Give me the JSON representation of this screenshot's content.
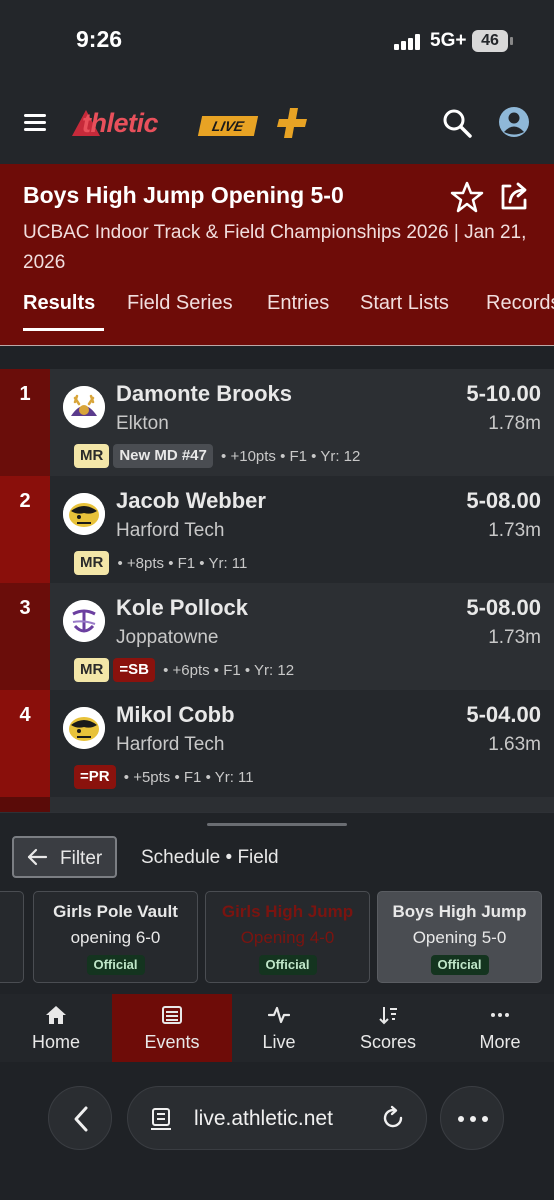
{
  "status_bar": {
    "time": "9:26",
    "network": "5G+",
    "battery": "46"
  },
  "header": {
    "logo_text": "thletic",
    "logo_badge": "LIVE"
  },
  "event": {
    "title": "Boys High Jump Opening 5-0",
    "subtitle": "UCBAC Indoor Track & Field Championships 2026 | Jan 21, 2026",
    "tabs": [
      "Results",
      "Field Series",
      "Entries",
      "Start Lists",
      "Records"
    ]
  },
  "results": [
    {
      "place": "1",
      "name": "Damonte Brooks",
      "school": "Elkton",
      "mark": "5-10.00",
      "metric": "1.78m",
      "badges": [
        "MR",
        "New MD #47"
      ],
      "meta": "• +10pts • F1 • Yr: 12"
    },
    {
      "place": "2",
      "name": "Jacob Webber",
      "school": "Harford Tech",
      "mark": "5-08.00",
      "metric": "1.73m",
      "badges": [
        "MR"
      ],
      "meta": "• +8pts • F1 • Yr: 11"
    },
    {
      "place": "3",
      "name": "Kole Pollock",
      "school": "Joppatowne",
      "mark": "5-08.00",
      "metric": "1.73m",
      "badges": [
        "MR",
        "=SB"
      ],
      "meta": "• +6pts • F1 • Yr: 12"
    },
    {
      "place": "4",
      "name": "Mikol Cobb",
      "school": "Harford Tech",
      "mark": "5-04.00",
      "metric": "1.63m",
      "badges": [
        "=PR"
      ],
      "meta": "• +5pts • F1 • Yr: 11"
    }
  ],
  "filter_sheet": {
    "filter_label": "Filter",
    "schedule_label": "Schedule • Field",
    "cards": [
      {
        "title": "Girls Pole Vault",
        "subtitle": "opening 6-0",
        "status": "Official"
      },
      {
        "title": "Girls High Jump",
        "subtitle": "Opening 4-0",
        "status": "Official"
      },
      {
        "title": "Boys High Jump",
        "subtitle": "Opening 5-0",
        "status": "Official"
      }
    ]
  },
  "bottom_nav": [
    {
      "label": "Home",
      "icon": "home-icon"
    },
    {
      "label": "Events",
      "icon": "list-icon"
    },
    {
      "label": "Live",
      "icon": "pulse-icon"
    },
    {
      "label": "Scores",
      "icon": "sort-icon"
    },
    {
      "label": "More",
      "icon": "more-icon"
    }
  ],
  "browser": {
    "url": "live.athletic.net"
  },
  "colors": {
    "brand_red": "#6e0c08",
    "highlight_red": "#8a0f0b",
    "mr_badge": "#f3e6a8",
    "official_green": "#14341f"
  }
}
